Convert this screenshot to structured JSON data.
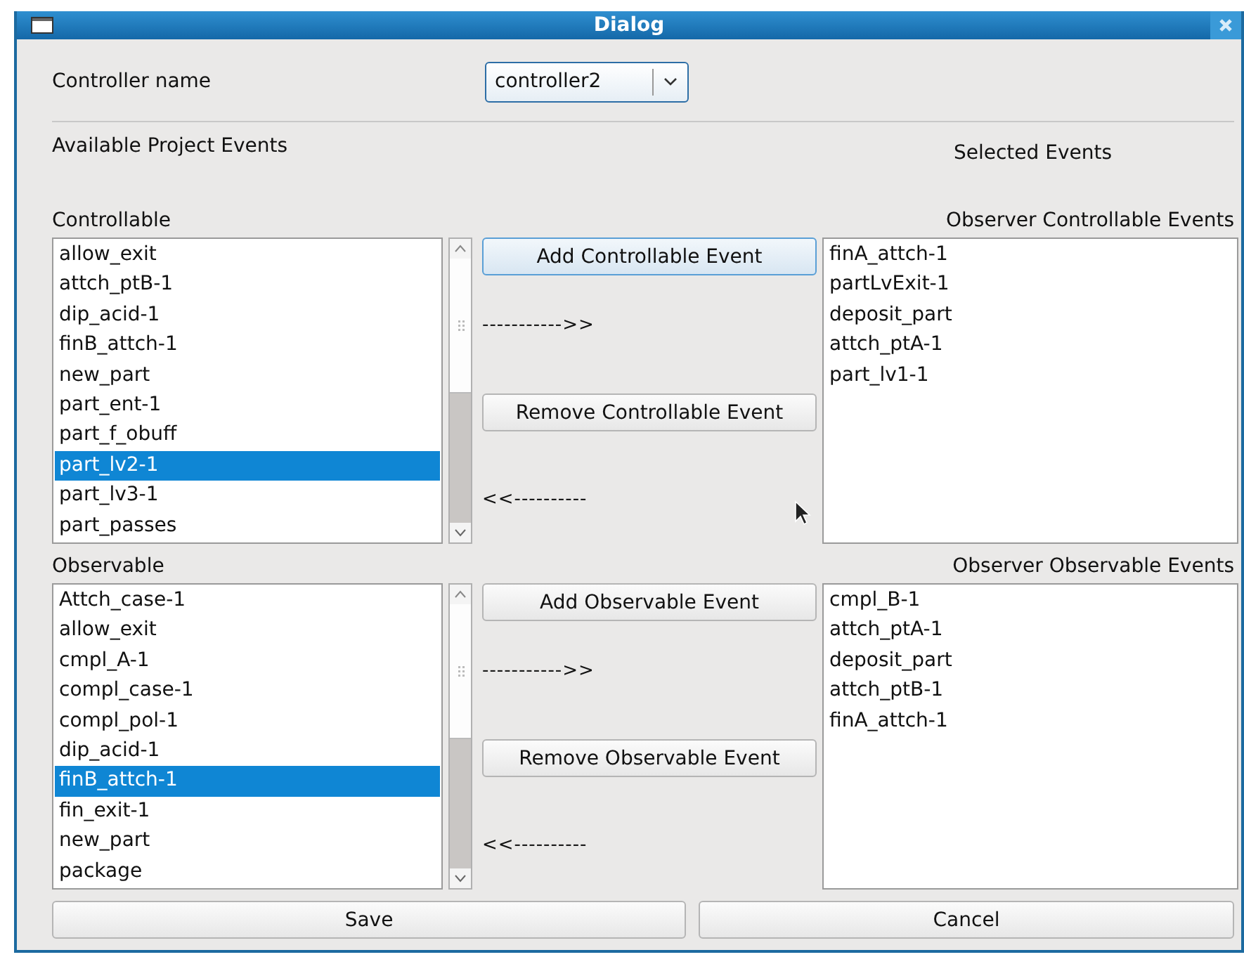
{
  "window": {
    "title": "Dialog"
  },
  "controller": {
    "label": "Controller name",
    "value": "controller2"
  },
  "available_heading": "Available Project Events",
  "selected_heading": "Selected Events",
  "sections": [
    {
      "label": "Controllable",
      "selected_label": "Observer Controllable Events",
      "items": [
        {
          "text": "allow_exit",
          "selected": false
        },
        {
          "text": "attch_ptB-1",
          "selected": false
        },
        {
          "text": "dip_acid-1",
          "selected": false
        },
        {
          "text": "finB_attch-1",
          "selected": false
        },
        {
          "text": "new_part",
          "selected": false
        },
        {
          "text": "part_ent-1",
          "selected": false
        },
        {
          "text": "part_f_obuff",
          "selected": false
        },
        {
          "text": "part_lv2-1",
          "selected": true
        },
        {
          "text": "part_lv3-1",
          "selected": false
        },
        {
          "text": "part_passes",
          "selected": false
        }
      ],
      "add_button": {
        "label": "Add Controllable Event",
        "focused": true
      },
      "add_arrow": "----------->>",
      "remove_button": {
        "label": "Remove Controllable Event",
        "focused": false
      },
      "remove_arrow": "<<----------",
      "selected_items": [
        "finA_attch-1",
        "partLvExit-1",
        "deposit_part",
        "attch_ptA-1",
        "part_lv1-1"
      ]
    },
    {
      "label": "Observable",
      "selected_label": "Observer Observable Events",
      "items": [
        {
          "text": "Attch_case-1",
          "selected": false
        },
        {
          "text": "allow_exit",
          "selected": false
        },
        {
          "text": "cmpl_A-1",
          "selected": false
        },
        {
          "text": "compl_case-1",
          "selected": false
        },
        {
          "text": "compl_pol-1",
          "selected": false
        },
        {
          "text": "dip_acid-1",
          "selected": false
        },
        {
          "text": "finB_attch-1",
          "selected": true
        },
        {
          "text": "fin_exit-1",
          "selected": false
        },
        {
          "text": "new_part",
          "selected": false
        },
        {
          "text": "package",
          "selected": false
        }
      ],
      "add_button": {
        "label": "Add Observable Event",
        "focused": false
      },
      "add_arrow": "----------->>",
      "remove_button": {
        "label": "Remove Observable Event",
        "focused": false
      },
      "remove_arrow": "<<----------",
      "selected_items": [
        "cmpl_B-1",
        "attch_ptA-1",
        "deposit_part",
        "attch_ptB-1",
        "finA_attch-1"
      ]
    }
  ],
  "buttons": [
    "Save",
    "Cancel"
  ]
}
